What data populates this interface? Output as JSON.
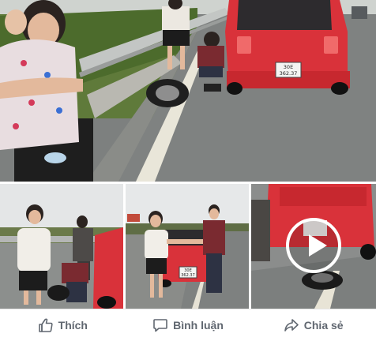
{
  "post": {
    "main_photo": {
      "alt": "Roadside photo with red car and people",
      "plate_line1": "30E",
      "plate_line2": "362.37"
    },
    "thumbnails": [
      {
        "type": "photo"
      },
      {
        "type": "photo",
        "plate_line1": "30E",
        "plate_line2": "362.37"
      },
      {
        "type": "video"
      }
    ],
    "actions": {
      "like_label": "Thích",
      "comment_label": "Bình luận",
      "share_label": "Chia sẻ"
    }
  },
  "colors": {
    "action_text": "#606770",
    "car_red": "#d9323a",
    "road": "#7f8281"
  },
  "icons": {
    "like": "thumbs-up-icon",
    "comment": "speech-bubble-icon",
    "share": "share-arrow-icon",
    "play": "play-icon"
  }
}
